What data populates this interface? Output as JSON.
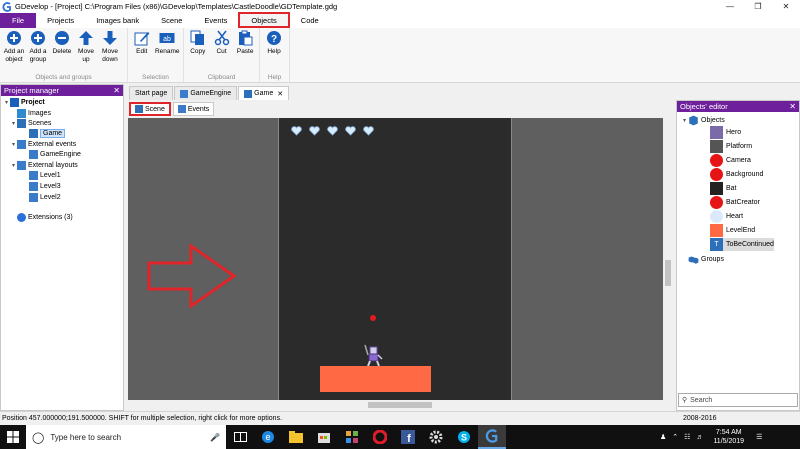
{
  "titlebar": {
    "title": "GDevelop - [Project] C:\\Program Files (x86)\\GDevelop\\Templates\\CastleDoodle\\GDTemplate.gdg"
  },
  "ribbon_tabs": [
    "File",
    "Projects",
    "Images bank",
    "Scene",
    "Events",
    "Objects",
    "Code"
  ],
  "ribbon": {
    "groups": [
      {
        "name": "Objects and groups",
        "buttons": [
          "Add an\nobject",
          "Add a\ngroup",
          "Delete",
          "Move\nup",
          "Move\ndown"
        ]
      },
      {
        "name": "Selection",
        "buttons": [
          "Edit",
          "Rename"
        ]
      },
      {
        "name": "Clipboard",
        "buttons": [
          "Copy",
          "Cut",
          "Paste"
        ]
      },
      {
        "name": "Help",
        "buttons": [
          "Help"
        ]
      }
    ]
  },
  "project_manager": {
    "title": "Project manager",
    "tree": {
      "project": "Project",
      "images": "Images",
      "scenes": "Scenes",
      "game": "Game",
      "external_events": "External events",
      "game_engine": "GameEngine",
      "external_layouts": "External layouts",
      "level1": "Level1",
      "level3": "Level3",
      "level2": "Level2",
      "extensions": "Extensions (3)"
    }
  },
  "doc_tabs": [
    "Start page",
    "GameEngine",
    "Game"
  ],
  "sub_tabs": [
    "Scene",
    "Events"
  ],
  "objects_editor": {
    "title": "Objects' editor",
    "root": "Objects",
    "items": [
      "Hero",
      "Platform",
      "Camera",
      "Background",
      "Bat",
      "BatCreator",
      "Heart",
      "LevelEnd",
      "ToBeContinued"
    ],
    "groups": "Groups",
    "search_placeholder": "Search"
  },
  "status": {
    "left": "Position 457.000000;191.500000. SHIFT for multiple selection, right click for more options.",
    "right": "2008-2016"
  },
  "taskbar": {
    "search": "Type here to search",
    "time": "7:54 AM",
    "date": "11/5/2019"
  },
  "colors": {
    "accent": "#6d1f9c",
    "highlight": "#e0252a",
    "platform": "#ff6a45"
  }
}
